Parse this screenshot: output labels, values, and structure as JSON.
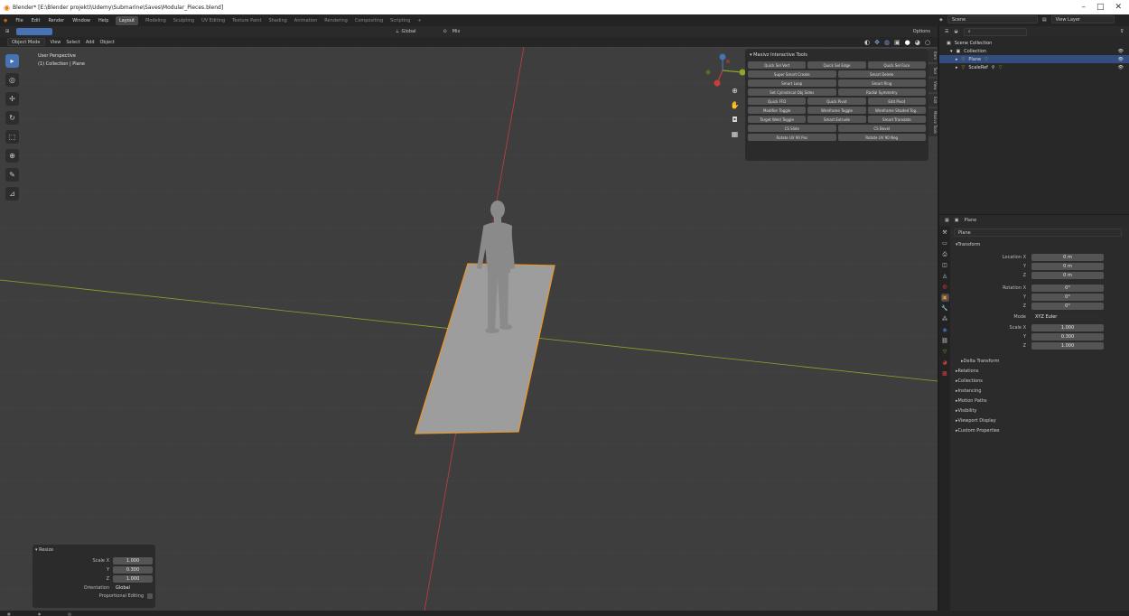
{
  "window": {
    "title": "Blender* [E:\\Blender projekti\\Udemy\\Submarine\\Saves\\Modular_Pieces.blend]"
  },
  "menu": [
    "File",
    "Edit",
    "Render",
    "Window",
    "Help"
  ],
  "workspaces": [
    "Layout",
    "Modeling",
    "Sculpting",
    "UV Editing",
    "Texture Paint",
    "Shading",
    "Animation",
    "Rendering",
    "Compositing",
    "Scripting"
  ],
  "scene": {
    "label": "Scene",
    "view_layer": "View Layer"
  },
  "viewport": {
    "mode": "Object Mode",
    "menus": [
      "View",
      "Select",
      "Add",
      "Object"
    ],
    "orientation": "Global",
    "mix": "Mix",
    "options": "Options",
    "perspective": "User Perspective",
    "collection": "(1) Collection | Plane"
  },
  "tools_panel": {
    "title": "Maxivz Interactive Tools",
    "rows": [
      [
        "Quick Sel Vert",
        "Quick Sel Edge",
        "Quick Sel Face"
      ],
      [
        "Super Smart Create",
        "Smart Delete"
      ],
      [
        "Smart Loop",
        "Smart Ring"
      ],
      [
        "Set Cylindrical Obj Sides",
        "Radial Symmetry"
      ],
      [
        "Quick FFD",
        "Quick Pivot",
        "Edit Pivot"
      ],
      [
        "Modifier Toggle",
        "Wireframe Toggle",
        "Wireframe Shaded Tog.."
      ],
      [
        "Target Weld Toggle",
        "Smart Extrude",
        "Smart Translate"
      ],
      [
        "CS Slide",
        "CS Bevel"
      ],
      [
        "Rotate UV 90 Pos",
        "Rotate UV 90 Neg"
      ]
    ]
  },
  "side_tabs": [
    "Item",
    "Tool",
    "View",
    "Edit",
    "Maxivz Tools"
  ],
  "resize": {
    "title": "Resize",
    "rows": [
      {
        "label": "Scale X",
        "value": "1.000"
      },
      {
        "label": "Y",
        "value": "0.300"
      },
      {
        "label": "Z",
        "value": "1.000"
      }
    ],
    "orientation_label": "Orientation",
    "orientation_value": "Global",
    "proportional": "Proportional Editing"
  },
  "outliner": {
    "rows": [
      {
        "label": "Scene Collection"
      },
      {
        "label": "Collection"
      },
      {
        "label": "Plane"
      },
      {
        "label": "ScaleRef"
      }
    ]
  },
  "properties": {
    "object": "Plane",
    "object_field": "Plane",
    "transform": "Transform",
    "location": [
      {
        "label": "Location X",
        "value": "0 m"
      },
      {
        "label": "Y",
        "value": "0 m"
      },
      {
        "label": "Z",
        "value": "0 m"
      }
    ],
    "rotation": [
      {
        "label": "Rotation X",
        "value": "0°"
      },
      {
        "label": "Y",
        "value": "0°"
      },
      {
        "label": "Z",
        "value": "0°"
      }
    ],
    "mode_label": "Mode",
    "mode_value": "XYZ Euler",
    "scale": [
      {
        "label": "Scale X",
        "value": "1.000"
      },
      {
        "label": "Y",
        "value": "0.300"
      },
      {
        "label": "Z",
        "value": "1.000"
      }
    ],
    "delta": "Delta Transform",
    "sections": [
      "Relations",
      "Collections",
      "Instancing",
      "Motion Paths",
      "Visibility",
      "Viewport Display",
      "Custom Properties"
    ]
  },
  "colors": {
    "accent": "#4772b3",
    "selection": "#e8962e",
    "x_axis": "#c83c3c",
    "y_axis": "#8aa82a"
  }
}
